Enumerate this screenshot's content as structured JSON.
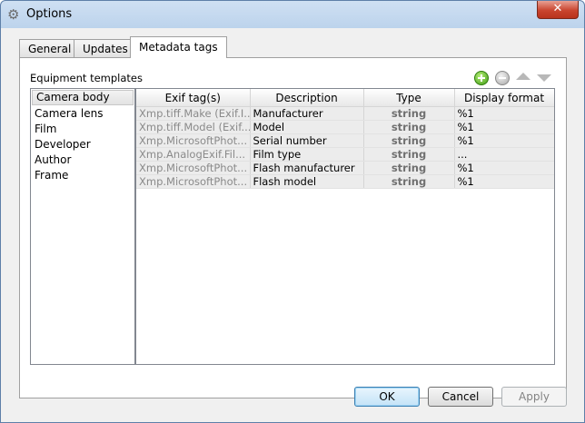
{
  "window": {
    "title": "Options",
    "close_label": "✕"
  },
  "tabs": [
    {
      "label": "General"
    },
    {
      "label": "Updates"
    },
    {
      "label": "Metadata tags"
    }
  ],
  "section_label": "Equipment templates",
  "templates": [
    "Camera body",
    "Camera lens",
    "Film",
    "Developer",
    "Author",
    "Frame"
  ],
  "selected_template": "Camera body",
  "grid": {
    "columns": [
      "Exif tag(s)",
      "Description",
      "Type",
      "Display format"
    ],
    "rows": [
      [
        "Xmp.tiff.Make (Exif.I...",
        "Manufacturer",
        "string",
        "%1"
      ],
      [
        "Xmp.tiff.Model (Exif....",
        "Model",
        "string",
        "%1"
      ],
      [
        "Xmp.MicrosoftPhot...",
        "Serial number",
        "string",
        "%1"
      ],
      [
        "Xmp.AnalogExif.Fil...",
        "Film type",
        "string",
        "..."
      ],
      [
        "Xmp.MicrosoftPhot...",
        "Flash manufacturer",
        "string",
        "%1"
      ],
      [
        "Xmp.MicrosoftPhot...",
        "Flash model",
        "string",
        "%1"
      ]
    ]
  },
  "buttons": {
    "ok": "OK",
    "cancel": "Cancel",
    "apply": "Apply"
  }
}
